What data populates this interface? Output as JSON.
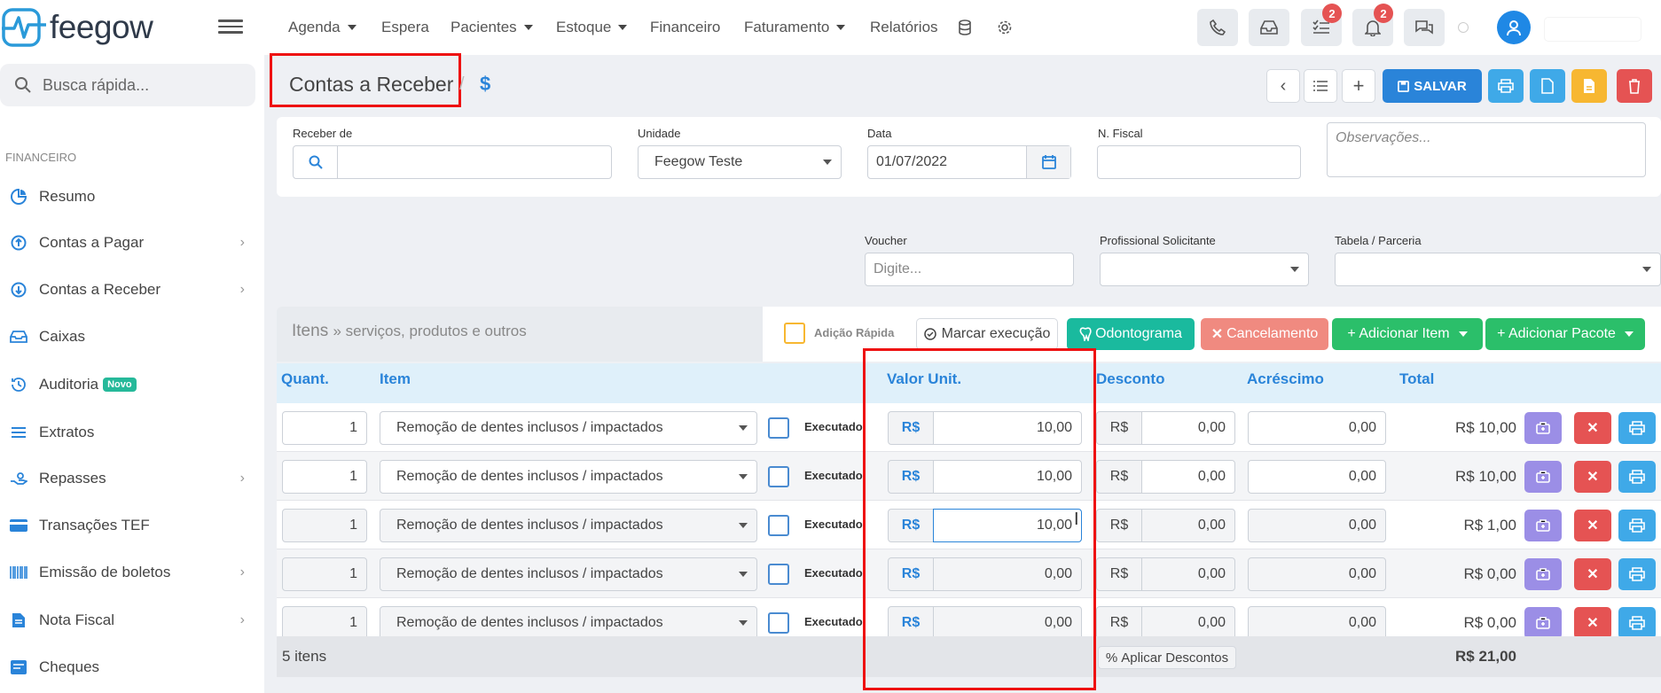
{
  "topbar": {
    "logo_text": "feegow",
    "nav": [
      {
        "label": "Agenda",
        "caret": true
      },
      {
        "label": "Espera",
        "caret": false
      },
      {
        "label": "Pacientes",
        "caret": true
      },
      {
        "label": "Estoque",
        "caret": true
      },
      {
        "label": "Financeiro",
        "caret": false
      },
      {
        "label": "Faturamento",
        "caret": true
      },
      {
        "label": "Relatórios",
        "caret": false
      }
    ],
    "tasks_badge": "2",
    "notifications_badge": "2"
  },
  "sidebar": {
    "search_placeholder": "Busca rápida...",
    "section_title": "FINANCEIRO",
    "items": [
      {
        "label": "Resumo",
        "icon": "pie-chart-icon",
        "chevron": false
      },
      {
        "label": "Contas a Pagar",
        "icon": "arrow-up-circle-icon",
        "chevron": true
      },
      {
        "label": "Contas a Receber",
        "icon": "arrow-down-circle-icon",
        "chevron": true
      },
      {
        "label": "Caixas",
        "icon": "inbox-icon",
        "chevron": false
      },
      {
        "label": "Auditoria",
        "icon": "history-icon",
        "chevron": false,
        "badge": "Novo"
      },
      {
        "label": "Extratos",
        "icon": "list-icon",
        "chevron": false
      },
      {
        "label": "Repasses",
        "icon": "hand-money-icon",
        "chevron": true
      },
      {
        "label": "Transações TEF",
        "icon": "credit-card-icon",
        "chevron": false
      },
      {
        "label": "Emissão de boletos",
        "icon": "barcode-icon",
        "chevron": true
      },
      {
        "label": "Nota Fiscal",
        "icon": "file-icon",
        "chevron": true
      },
      {
        "label": "Cheques",
        "icon": "check-icon",
        "chevron": false
      }
    ]
  },
  "header": {
    "title": "Contas a Receber",
    "separator": "/",
    "dollar": "$",
    "save_label": "SALVAR"
  },
  "form": {
    "receber_de_label": "Receber de",
    "unidade_label": "Unidade",
    "unidade_value": "Feegow Teste",
    "data_label": "Data",
    "data_value": "01/07/2022",
    "nfiscal_label": "N. Fiscal",
    "observacoes_placeholder": "Observações...",
    "voucher_label": "Voucher",
    "voucher_placeholder": "Digite...",
    "profissional_label": "Profissional Solicitante",
    "tabela_label": "Tabela / Parceria"
  },
  "items_bar": {
    "title": "Itens",
    "subtitle": "» serviços, produtos e outros",
    "adicao_rapida": "Adição Rápida",
    "marcar_execucao": "Marcar execução",
    "odontograma": "Odontograma",
    "cancelamento": "Cancelamento",
    "adicionar_item": "+ Adicionar Item",
    "adicionar_pacote": "+ Adicionar Pacote"
  },
  "table": {
    "headers": {
      "quant": "Quant.",
      "item": "Item",
      "valor_unit": "Valor Unit.",
      "desconto": "Desconto",
      "acrescimo": "Acréscimo",
      "total": "Total"
    },
    "currency": "R$",
    "executado_label": "Executado",
    "rows": [
      {
        "qty": "1",
        "item": "Remoção de dentes inclusos / impactados",
        "valor": "10,00",
        "desconto": "0,00",
        "acrescimo": "0,00",
        "total": "R$ 10,00",
        "enabled": true
      },
      {
        "qty": "1",
        "item": "Remoção de dentes inclusos / impactados",
        "valor": "10,00",
        "desconto": "0,00",
        "acrescimo": "0,00",
        "total": "R$ 10,00",
        "enabled": true
      },
      {
        "qty": "1",
        "item": "Remoção de dentes inclusos / impactados",
        "valor": "10,00",
        "desconto": "0,00",
        "acrescimo": "0,00",
        "total": "R$ 1,00",
        "enabled": false
      },
      {
        "qty": "1",
        "item": "Remoção de dentes inclusos / impactados",
        "valor": "0,00",
        "desconto": "0,00",
        "acrescimo": "0,00",
        "total": "R$ 0,00",
        "enabled": false
      },
      {
        "qty": "1",
        "item": "Remoção de dentes inclusos / impactados",
        "valor": "0,00",
        "desconto": "0,00",
        "acrescimo": "0,00",
        "total": "R$ 0,00",
        "enabled": false
      }
    ],
    "footer": {
      "count": "5 itens",
      "aplicar_descontos": "Aplicar Descontos",
      "grand_total": "R$ 21,00"
    }
  },
  "colors": {
    "primary": "#2a84d9",
    "success": "#2bbf6a",
    "teal": "#1aba9e",
    "danger": "#e55353",
    "salmon": "#f08a80",
    "purple": "#9b8ee6",
    "info": "#3fa9e8",
    "warning": "#f7b731",
    "highlight": "#ee1111"
  }
}
